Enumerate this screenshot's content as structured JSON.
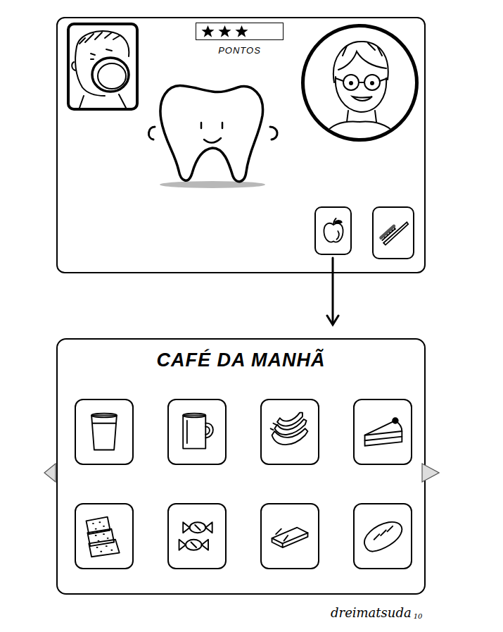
{
  "score": {
    "label": "PONTOS",
    "stars": 3
  },
  "actions": [
    {
      "kind": "food",
      "selected": true
    },
    {
      "kind": "brush",
      "selected": false
    }
  ],
  "menu": {
    "title": "CAFÉ DA MANHÃ",
    "items": [
      {
        "kind": "water"
      },
      {
        "kind": "mug"
      },
      {
        "kind": "banana"
      },
      {
        "kind": "cake"
      },
      {
        "kind": "crackers"
      },
      {
        "kind": "candy"
      },
      {
        "kind": "chocolate"
      },
      {
        "kind": "bread"
      }
    ]
  },
  "signature": {
    "name": "dreimatsuda",
    "year": "10"
  }
}
